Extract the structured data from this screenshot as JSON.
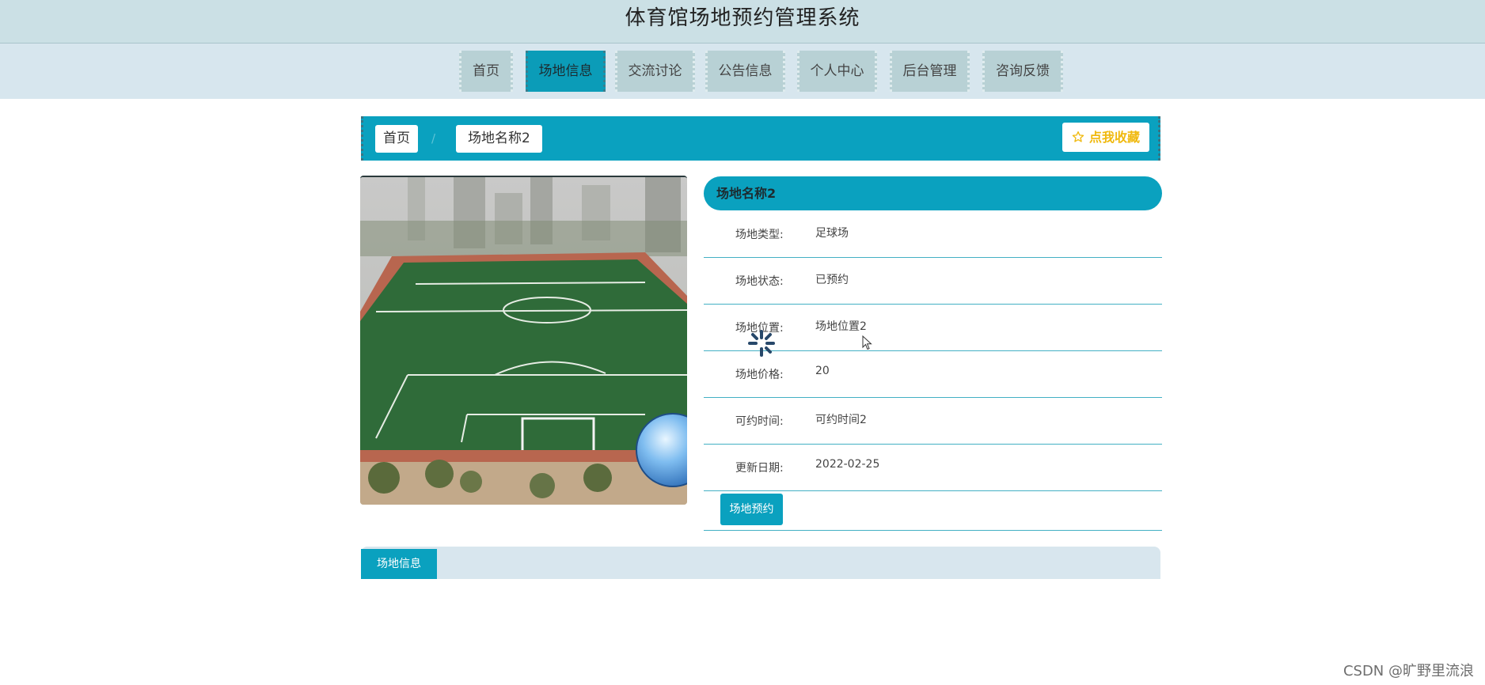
{
  "header": {
    "title": "体育馆场地预约管理系统"
  },
  "nav": {
    "items": [
      {
        "label": "首页"
      },
      {
        "label": "场地信息"
      },
      {
        "label": "交流讨论"
      },
      {
        "label": "公告信息"
      },
      {
        "label": "个人中心"
      },
      {
        "label": "后台管理"
      },
      {
        "label": "咨询反馈"
      }
    ],
    "active_index": 1
  },
  "breadcrumb": {
    "home": "首页",
    "separator": "/",
    "current": "场地名称2"
  },
  "favorite": {
    "icon": "star-outline-icon",
    "label": "点我收藏"
  },
  "detail": {
    "title": "场地名称2",
    "fields": [
      {
        "label": "场地类型:",
        "value": "足球场"
      },
      {
        "label": "场地状态:",
        "value": "已预约"
      },
      {
        "label": "场地位置:",
        "value": "场地位置2"
      },
      {
        "label": "场地价格:",
        "value": "20"
      },
      {
        "label": "可约时间:",
        "value": "可约时间2"
      },
      {
        "label": "更新日期:",
        "value": "2022-02-25"
      }
    ],
    "book_button": "场地预约"
  },
  "tabs": {
    "active": "场地信息"
  },
  "watermark": "CSDN @旷野里流浪",
  "colors": {
    "accent": "#0aa1bf",
    "nav_bg": "#b8d1d5",
    "header_bg": "#cbe0e5",
    "star": "#f0b90f"
  }
}
